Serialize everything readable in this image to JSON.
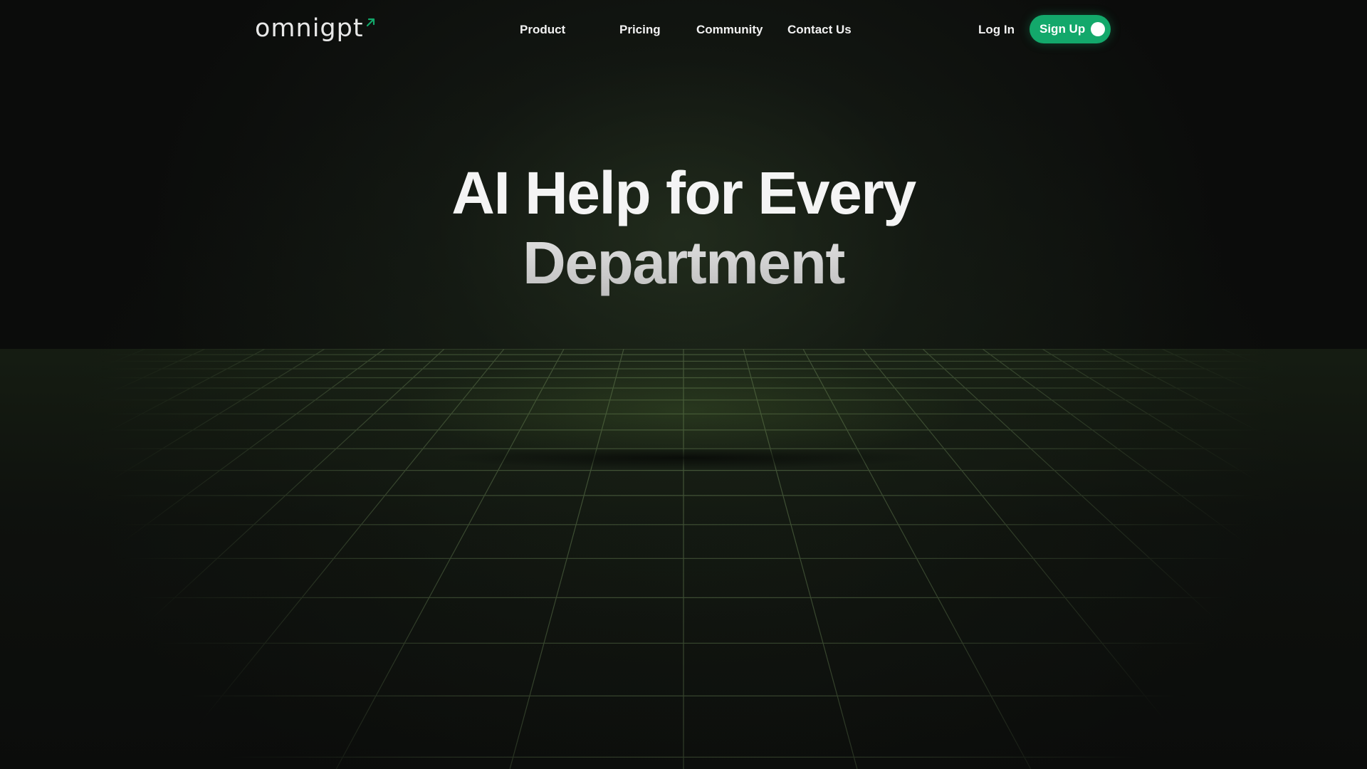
{
  "brand": {
    "name": "omnigpt",
    "accent_color": "#13a86b"
  },
  "nav": {
    "items": [
      {
        "label": "Product"
      },
      {
        "label": "Pricing"
      },
      {
        "label": "Community"
      },
      {
        "label": "Contact Us"
      }
    ],
    "login_label": "Log In",
    "signup_label": "Sign Up"
  },
  "hero": {
    "title_line1": "AI Help for Every",
    "title_line2": "Department"
  },
  "colors": {
    "background": "#0b0c0b",
    "grid_line": "#3a4a30"
  }
}
